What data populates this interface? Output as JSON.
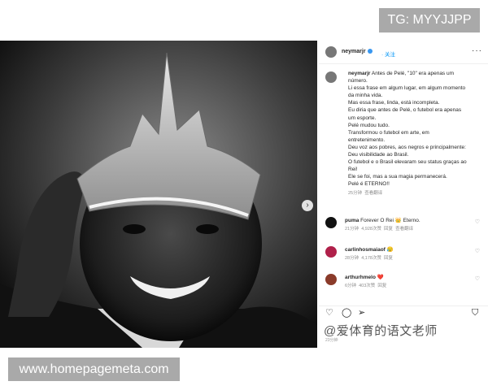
{
  "tg_badge": "TG: MYYJJPP",
  "site_badge": "www.homepagemeta.com",
  "post": {
    "username": "neymarjr",
    "follow_label": "关注",
    "caption_user": "neymarjr",
    "caption_lines": [
      "Antes de Pelé, \"10\" era apenas um",
      "número.",
      "Li essa frase em algum lugar, em algum momento",
      "da minha vida.",
      "Mas essa frase, linda, está incompleta.",
      "Eu diria que antes de Pelé, o futebol era apenas",
      "um esporte.",
      "Pelé mudou tudo.",
      "Transformou o futebol em arte, em",
      "entretenimento.",
      "Deu voz aos pobres, aos negros e principalmente:",
      "Deu visibilidade ao Brasil.",
      "O futebol e o Brasil elevaram seu status graças ao",
      "Rei!",
      "Ele se foi, mas a sua magia permanecerá.",
      "Pelé é ETERNO!!"
    ],
    "caption_time": "25分钟",
    "caption_translate": "查看翻译"
  },
  "comments": [
    {
      "user": "puma",
      "text": "Forever O Rei 👑 Eterno.",
      "time": "21分钟",
      "likes": "4,928次赞",
      "reply": "回复",
      "translate": "查看翻译"
    },
    {
      "user": "carlinhosmaiaof",
      "text": "😥",
      "time": "28分钟",
      "likes": "4,178次赞",
      "reply": "回复"
    },
    {
      "user": "arthurhmelo",
      "text": "❤️",
      "time": "6分钟",
      "likes": "403次赞",
      "reply": "回复"
    }
  ],
  "watermark": "@爱体育的语文老师",
  "date_small": "23分钟",
  "colors": {
    "link": "#0095f6",
    "badge_bg": "#a9a9a9"
  }
}
